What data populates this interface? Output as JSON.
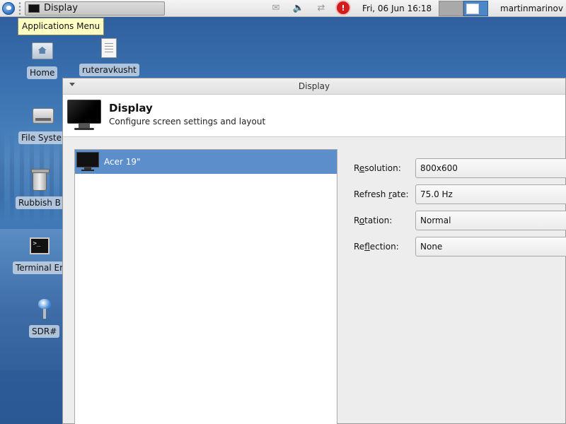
{
  "panel": {
    "task_label": "Display",
    "clock": "Fri, 06 Jun  16:18",
    "user": "martinmarinov"
  },
  "tooltip": "Applications Menu",
  "desktop": {
    "icons": [
      {
        "label": "Home",
        "icon": "home-icon"
      },
      {
        "label": "ruteravkusht",
        "icon": "text-file-icon"
      },
      {
        "label": "File Syster",
        "icon": "drive-icon"
      },
      {
        "label": "Rubbish B",
        "icon": "trash-icon"
      },
      {
        "label": "Terminal Er",
        "icon": "terminal-icon"
      },
      {
        "label": "SDR#",
        "icon": "sdr-app-icon"
      }
    ]
  },
  "dialog": {
    "window_title": "Display",
    "header_title": "Display",
    "header_subtitle": "Configure screen settings and layout",
    "displays": [
      {
        "name": "Acer 19\"",
        "selected": true
      }
    ],
    "settings": {
      "resolution": {
        "label_pre": "R",
        "label_ul": "e",
        "label_post": "solution:",
        "value": "800x600"
      },
      "refresh": {
        "label_pre": "Refresh ",
        "label_ul": "r",
        "label_post": "ate:",
        "value": "75.0 Hz"
      },
      "rotation": {
        "label_pre": "R",
        "label_ul": "o",
        "label_post": "tation:",
        "value": "Normal"
      },
      "reflection": {
        "label_pre": "Re",
        "label_ul": "f",
        "label_post": "lection:",
        "value": "None"
      }
    }
  },
  "colors": {
    "selection": "#5b8ecb",
    "tooltip_bg": "#ffffc4",
    "alert": "#d21b1b"
  }
}
